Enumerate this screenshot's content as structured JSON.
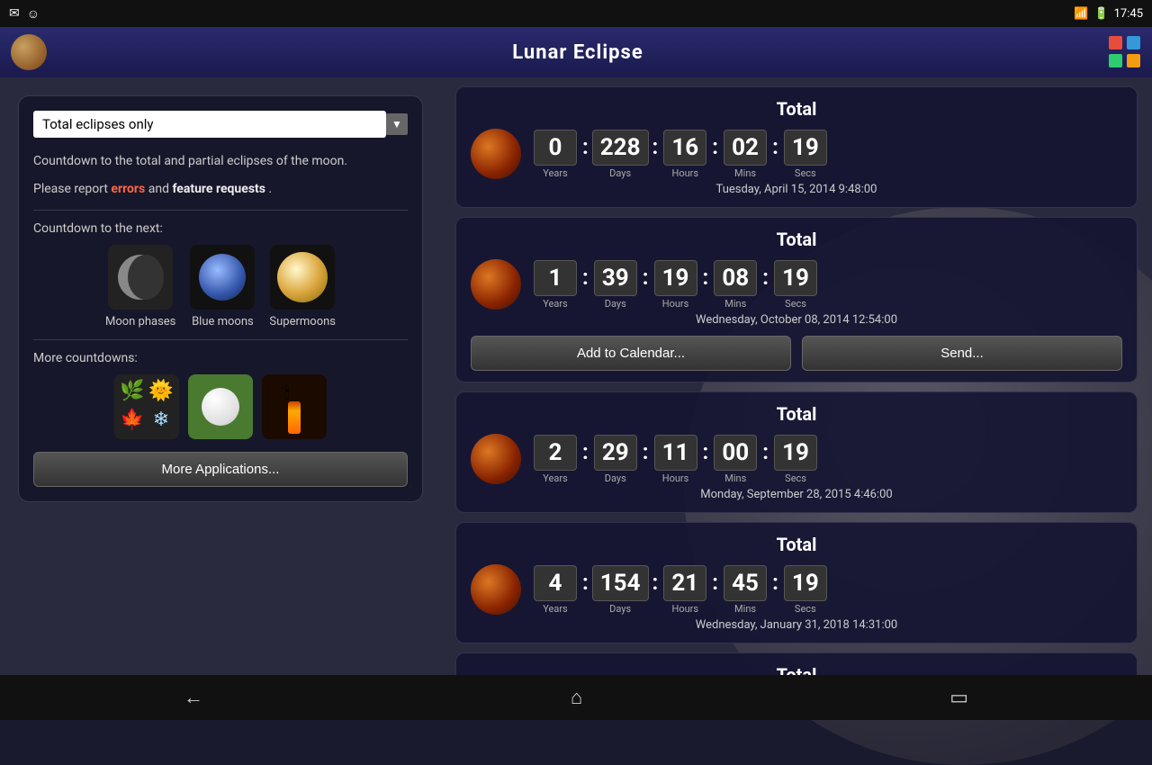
{
  "statusBar": {
    "time": "17:45",
    "icons": [
      "✉",
      "☺"
    ]
  },
  "appBar": {
    "title": "Lunar Eclipse",
    "gridColors": [
      "#e74c3c",
      "#3498db",
      "#2ecc71",
      "#f39c12"
    ]
  },
  "leftPanel": {
    "dropdown": {
      "label": "Total eclipses only",
      "placeholder": "Total eclipses only"
    },
    "description1": "Countdown to the total and partial eclipses of the moon.",
    "description2": "Please report ",
    "errors": "errors",
    "and": " and ",
    "featureRequests": "feature requests",
    "period": ".",
    "countdownLabel": "Countdown to the next:",
    "moonPhaseLabel": "Moon phases",
    "blueMoonLabel": "Blue moons",
    "supermoonLabel": "Supermoons",
    "moreCountdownsLabel": "More countdowns:",
    "moreAppsBtn": "More Applications..."
  },
  "eclipses": [
    {
      "type": "Total",
      "years": "0",
      "days": "228",
      "hours": "16",
      "mins": "02",
      "secs": "19",
      "date": "Tuesday, April 15, 2014  9:48:00",
      "hasButtons": false
    },
    {
      "type": "Total",
      "years": "1",
      "days": "39",
      "hours": "19",
      "mins": "08",
      "secs": "19",
      "date": "Wednesday, October 08, 2014  12:54:00",
      "hasButtons": true,
      "addToCalendar": "Add to Calendar...",
      "send": "Send..."
    },
    {
      "type": "Total",
      "years": "2",
      "days": "29",
      "hours": "11",
      "mins": "00",
      "secs": "19",
      "date": "Monday, September 28, 2015  4:46:00",
      "hasButtons": false
    },
    {
      "type": "Total",
      "years": "4",
      "days": "154",
      "hours": "21",
      "mins": "45",
      "secs": "19",
      "date": "Wednesday, January 31, 2018  14:31:00",
      "hasButtons": false
    },
    {
      "type": "Total",
      "partial": true
    }
  ],
  "labels": {
    "years": "Years",
    "days": "Days",
    "hours": "Hours",
    "mins": "Mins",
    "secs": "Secs"
  },
  "nav": {
    "back": "←",
    "home": "⌂",
    "recent": "▭"
  }
}
